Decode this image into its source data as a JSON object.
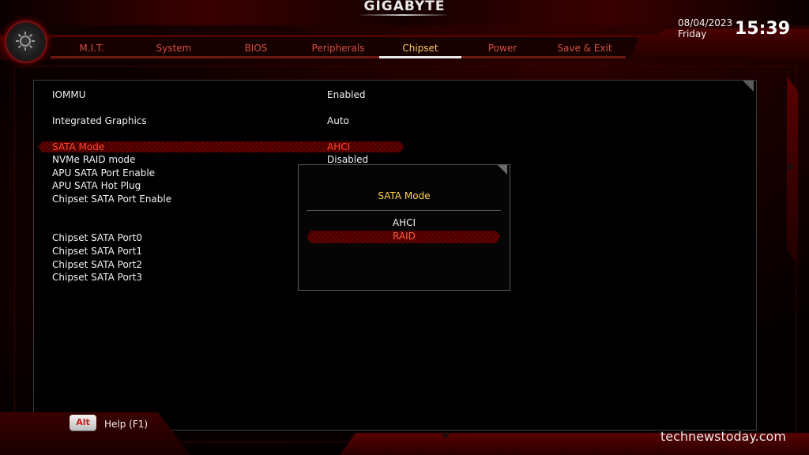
{
  "header": {
    "brand": "GIGABYTE",
    "date": "08/04/2023",
    "day": "Friday",
    "time": "15:39"
  },
  "tabs": [
    {
      "label": "M.I.T.",
      "active": false
    },
    {
      "label": "System",
      "active": false
    },
    {
      "label": "BIOS",
      "active": false
    },
    {
      "label": "Peripherals",
      "active": false
    },
    {
      "label": "Chipset",
      "active": true
    },
    {
      "label": "Power",
      "active": false
    },
    {
      "label": "Save & Exit",
      "active": false
    }
  ],
  "settings": {
    "iommu": {
      "label": "IOMMU",
      "value": "Enabled"
    },
    "integrated_graphics": {
      "label": "Integrated Graphics",
      "value": "Auto"
    },
    "sata_mode": {
      "label": "SATA Mode",
      "value": "AHCI"
    },
    "nvme_raid": {
      "label": "NVMe RAID mode",
      "value": "Disabled"
    },
    "apu_sata_port_enable": {
      "label": "APU SATA Port Enable"
    },
    "apu_sata_hot_plug": {
      "label": "APU SATA Hot Plug"
    },
    "chipset_sata_port_enable": {
      "label": "Chipset SATA Port Enable"
    },
    "chipset_sata_port0": {
      "label": "Chipset SATA Port0"
    },
    "chipset_sata_port1": {
      "label": "Chipset SATA Port1"
    },
    "chipset_sata_port2": {
      "label": "Chipset SATA Port2"
    },
    "chipset_sata_port3": {
      "label": "Chipset SATA Port3"
    }
  },
  "popup": {
    "title": "SATA Mode",
    "options": [
      "AHCI",
      "RAID"
    ],
    "selected": "RAID"
  },
  "footer": {
    "alt_key": "Alt",
    "help": "Help (F1)"
  },
  "watermark": "technewstoday.com",
  "colors": {
    "accent_red": "#ff4a2a",
    "active_tab": "#ffcc66",
    "popup_title": "#ffd24a"
  }
}
